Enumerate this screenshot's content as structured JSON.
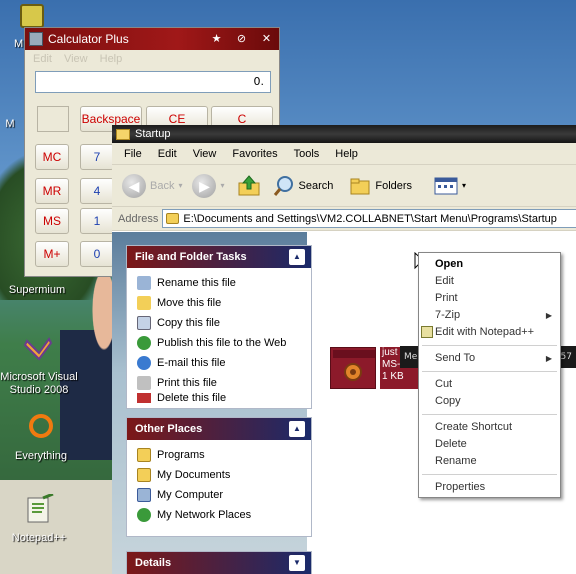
{
  "desktop": {
    "icons": [
      {
        "name": "M C",
        "partial": true
      },
      {
        "name": "M"
      },
      {
        "name": "Supermium"
      },
      {
        "name": "Microsoft Visual Studio 2008"
      },
      {
        "name": "Everything"
      },
      {
        "name": "Notepad++"
      }
    ]
  },
  "calculator": {
    "title": "Calculator Plus",
    "menu": [
      "Edit",
      "View",
      "Help"
    ],
    "display": "0.",
    "buttons": {
      "backspace": "Backspace",
      "ce": "CE",
      "c": "C",
      "mc": "MC",
      "mr": "MR",
      "ms": "MS",
      "mplus": "M+",
      "d7": "7",
      "d4": "4",
      "d1": "1",
      "d0": "0"
    }
  },
  "explorer": {
    "title": "Startup",
    "menu": [
      "File",
      "Edit",
      "View",
      "Favorites",
      "Tools",
      "Help"
    ],
    "toolbar": {
      "back": "Back",
      "search": "Search",
      "folders": "Folders"
    },
    "address_label": "Address",
    "address": "E:\\Documents and Settings\\VM2.COLLABNET\\Start Menu\\Programs\\Startup",
    "file_tasks": {
      "title": "File and Folder Tasks",
      "items": [
        "Rename this file",
        "Move this file",
        "Copy this file",
        "Publish this file to the Web",
        "E-mail this file",
        "Print this file",
        "Delete this file"
      ]
    },
    "other_places": {
      "title": "Other Places",
      "items": [
        "Programs",
        "My Documents",
        "My Computer",
        "My Network Places"
      ]
    },
    "details": {
      "title": "Details"
    },
    "file": {
      "name": "just spam",
      "type": "MS-DOS",
      "size": "1 KB"
    }
  },
  "tooltip_strip": {
    "left": "Me",
    "right": "57"
  },
  "context_menu": {
    "items": [
      {
        "label": "Open",
        "bold": true
      },
      {
        "label": "Edit"
      },
      {
        "label": "Print"
      },
      {
        "label": "7-Zip",
        "submenu": true
      },
      {
        "label": "Edit with Notepad++"
      },
      {
        "sep": true
      },
      {
        "label": "Send To",
        "submenu": true
      },
      {
        "sep": true
      },
      {
        "label": "Cut"
      },
      {
        "label": "Copy"
      },
      {
        "sep": true
      },
      {
        "label": "Create Shortcut"
      },
      {
        "label": "Delete"
      },
      {
        "label": "Rename"
      },
      {
        "sep": true
      },
      {
        "label": "Properties"
      }
    ]
  }
}
